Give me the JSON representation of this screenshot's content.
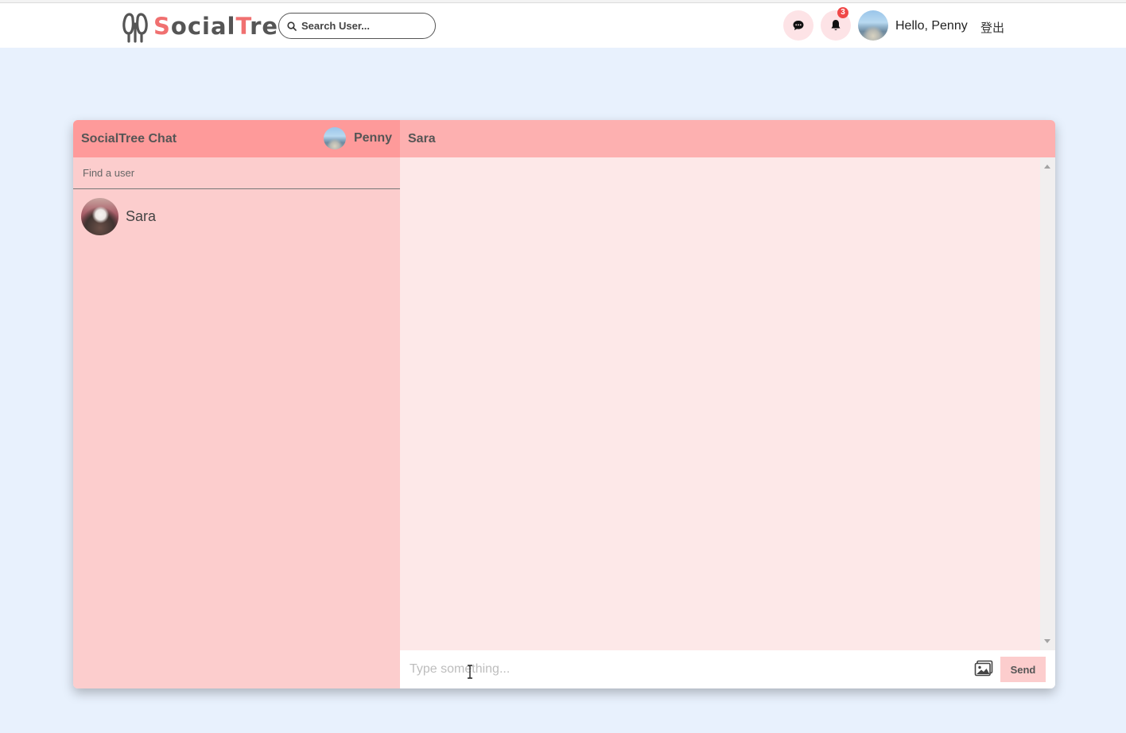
{
  "app": {
    "logo_prefix_accent": "S",
    "logo_part2": "ocial",
    "logo_accent2": "T",
    "logo_part3": "ree"
  },
  "navbar": {
    "search_placeholder": "Search User...",
    "notification_count": "3",
    "greeting": "Hello, Penny",
    "logout_label": "登出"
  },
  "chat": {
    "title": "SocialTree Chat",
    "current_user": "Penny",
    "find_placeholder": "Find a user",
    "users": [
      {
        "name": "Sara"
      }
    ],
    "active_chat": "Sara",
    "message_placeholder": "Type something...",
    "send_label": "Send"
  },
  "colors": {
    "accent": "#f07070",
    "sidebar_bg": "#fccdcd",
    "header_bg": "#fe9a9a",
    "main_header_bg": "#fdb0b0",
    "page_bg": "#e8f1fd"
  },
  "icons": [
    "tree-logo-icon",
    "search-icon",
    "chat-bubble-icon",
    "bell-icon",
    "image-icon"
  ]
}
